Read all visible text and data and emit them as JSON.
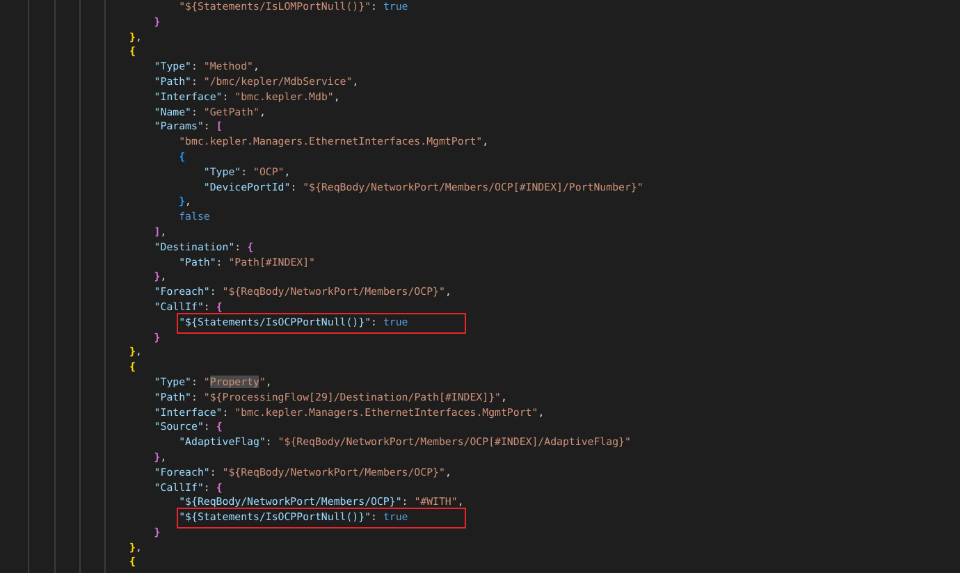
{
  "editor": {
    "lines": [
      {
        "children": [
          {
            "children": [
              {
                "boxed": false,
                "tokens": [
                  {
                    "kind": "string",
                    "text": "\"${Statements/IsLOMPortNull()}\""
                  },
                  {
                    "kind": "punct",
                    "text": ": "
                  },
                  {
                    "kind": "literal",
                    "text": "true"
                  }
                ]
              }
            ]
          },
          {
            "boxed": false,
            "tokens": [
              {
                "kind": "bracket",
                "color": "#da70d6",
                "text": "}"
              }
            ]
          }
        ]
      },
      {
        "boxed": false,
        "tokens": [
          {
            "kind": "bracket",
            "color": "#ffd700",
            "text": "}"
          },
          {
            "kind": "punct",
            "text": ","
          }
        ]
      },
      {
        "boxed": false,
        "tokens": [
          {
            "kind": "bracket",
            "color": "#ffd700",
            "text": "{"
          }
        ],
        "children": [
          {
            "boxed": false,
            "tokens": [
              {
                "kind": "key",
                "text": "\"Type\""
              },
              {
                "kind": "punct",
                "text": ": "
              },
              {
                "kind": "string",
                "text": "\"Method\""
              },
              {
                "kind": "punct",
                "text": ","
              }
            ]
          },
          {
            "boxed": false,
            "tokens": [
              {
                "kind": "key",
                "text": "\"Path\""
              },
              {
                "kind": "punct",
                "text": ": "
              },
              {
                "kind": "string",
                "text": "\"/bmc/kepler/MdbService\""
              },
              {
                "kind": "punct",
                "text": ","
              }
            ]
          },
          {
            "boxed": false,
            "tokens": [
              {
                "kind": "key",
                "text": "\"Interface\""
              },
              {
                "kind": "punct",
                "text": ": "
              },
              {
                "kind": "string",
                "text": "\"bmc.kepler.Mdb\""
              },
              {
                "kind": "punct",
                "text": ","
              }
            ]
          },
          {
            "boxed": false,
            "tokens": [
              {
                "kind": "key",
                "text": "\"Name\""
              },
              {
                "kind": "punct",
                "text": ": "
              },
              {
                "kind": "string",
                "text": "\"GetPath\""
              },
              {
                "kind": "punct",
                "text": ","
              }
            ]
          },
          {
            "boxed": false,
            "tokens": [
              {
                "kind": "key",
                "text": "\"Params\""
              },
              {
                "kind": "punct",
                "text": ": "
              },
              {
                "kind": "bracket",
                "color": "#da70d6",
                "text": "["
              }
            ],
            "children": [
              {
                "boxed": false,
                "tokens": [
                  {
                    "kind": "string",
                    "text": "\"bmc.kepler.Managers.EthernetInterfaces.MgmtPort\""
                  },
                  {
                    "kind": "punct",
                    "text": ","
                  }
                ]
              },
              {
                "boxed": false,
                "tokens": [
                  {
                    "kind": "bracket",
                    "color": "#179fff",
                    "text": "{"
                  }
                ],
                "children": [
                  {
                    "boxed": false,
                    "tokens": [
                      {
                        "kind": "key",
                        "text": "\"Type\""
                      },
                      {
                        "kind": "punct",
                        "text": ": "
                      },
                      {
                        "kind": "string",
                        "text": "\"OCP\""
                      },
                      {
                        "kind": "punct",
                        "text": ","
                      }
                    ]
                  },
                  {
                    "boxed": false,
                    "tokens": [
                      {
                        "kind": "key",
                        "text": "\"DevicePortId\""
                      },
                      {
                        "kind": "punct",
                        "text": ": "
                      },
                      {
                        "kind": "string",
                        "text": "\"${ReqBody/NetworkPort/Members/OCP[#INDEX]/PortNumber}\""
                      }
                    ]
                  }
                ]
              },
              {
                "boxed": false,
                "tokens": [
                  {
                    "kind": "bracket",
                    "color": "#179fff",
                    "text": "}"
                  },
                  {
                    "kind": "punct",
                    "text": ","
                  }
                ]
              },
              {
                "boxed": false,
                "tokens": [
                  {
                    "kind": "literal",
                    "text": "false"
                  }
                ]
              }
            ]
          },
          {
            "boxed": false,
            "tokens": [
              {
                "kind": "bracket",
                "color": "#da70d6",
                "text": "]"
              },
              {
                "kind": "punct",
                "text": ","
              }
            ]
          },
          {
            "boxed": false,
            "tokens": [
              {
                "kind": "key",
                "text": "\"Destination\""
              },
              {
                "kind": "punct",
                "text": ": "
              },
              {
                "kind": "bracket",
                "color": "#da70d6",
                "text": "{"
              }
            ],
            "children": [
              {
                "boxed": false,
                "tokens": [
                  {
                    "kind": "key",
                    "text": "\"Path\""
                  },
                  {
                    "kind": "punct",
                    "text": ": "
                  },
                  {
                    "kind": "string",
                    "text": "\"Path[#INDEX]\""
                  }
                ]
              }
            ]
          },
          {
            "boxed": false,
            "tokens": [
              {
                "kind": "bracket",
                "color": "#da70d6",
                "text": "}"
              },
              {
                "kind": "punct",
                "text": ","
              }
            ]
          },
          {
            "boxed": false,
            "tokens": [
              {
                "kind": "key",
                "text": "\"Foreach\""
              },
              {
                "kind": "punct",
                "text": ": "
              },
              {
                "kind": "string",
                "text": "\"${ReqBody/NetworkPort/Members/OCP}\""
              },
              {
                "kind": "punct",
                "text": ","
              }
            ]
          },
          {
            "boxed": false,
            "tokens": [
              {
                "kind": "key",
                "text": "\"CallIf\""
              },
              {
                "kind": "punct",
                "text": ": "
              },
              {
                "kind": "bracket",
                "color": "#da70d6",
                "text": "{"
              }
            ],
            "children": [
              {
                "boxed": true,
                "tokens": [
                  {
                    "kind": "key",
                    "text": "\"${Statements/IsOCPPortNull()}\""
                  },
                  {
                    "kind": "punct",
                    "text": ": "
                  },
                  {
                    "kind": "literal",
                    "text": "true"
                  }
                ]
              }
            ]
          },
          {
            "boxed": false,
            "tokens": [
              {
                "kind": "bracket",
                "color": "#da70d6",
                "text": "}"
              }
            ]
          }
        ]
      },
      {
        "boxed": false,
        "tokens": [
          {
            "kind": "bracket",
            "color": "#ffd700",
            "text": "}"
          },
          {
            "kind": "punct",
            "text": ","
          }
        ]
      },
      {
        "boxed": false,
        "tokens": [
          {
            "kind": "bracket",
            "color": "#ffd700",
            "text": "{"
          }
        ],
        "children": [
          {
            "boxed": false,
            "tokens": [
              {
                "kind": "key",
                "text": "\"Type\""
              },
              {
                "kind": "punct",
                "text": ": "
              },
              {
                "kind": "string",
                "text": "\""
              },
              {
                "kind": "match",
                "text": "Property"
              },
              {
                "kind": "string",
                "text": "\""
              },
              {
                "kind": "punct",
                "text": ","
              }
            ]
          },
          {
            "boxed": false,
            "tokens": [
              {
                "kind": "key",
                "text": "\"Path\""
              },
              {
                "kind": "punct",
                "text": ": "
              },
              {
                "kind": "string",
                "text": "\"${ProcessingFlow[29]/Destination/Path[#INDEX]}\""
              },
              {
                "kind": "punct",
                "text": ","
              }
            ]
          },
          {
            "boxed": false,
            "tokens": [
              {
                "kind": "key",
                "text": "\"Interface\""
              },
              {
                "kind": "punct",
                "text": ": "
              },
              {
                "kind": "string",
                "text": "\"bmc.kepler.Managers.EthernetInterfaces.MgmtPort\""
              },
              {
                "kind": "punct",
                "text": ","
              }
            ]
          },
          {
            "boxed": false,
            "tokens": [
              {
                "kind": "key",
                "text": "\"Source\""
              },
              {
                "kind": "punct",
                "text": ": "
              },
              {
                "kind": "bracket",
                "color": "#da70d6",
                "text": "{"
              }
            ],
            "children": [
              {
                "boxed": false,
                "tokens": [
                  {
                    "kind": "key",
                    "text": "\"AdaptiveFlag\""
                  },
                  {
                    "kind": "punct",
                    "text": ": "
                  },
                  {
                    "kind": "string",
                    "text": "\"${ReqBody/NetworkPort/Members/OCP[#INDEX]/AdaptiveFlag}\""
                  }
                ]
              }
            ]
          },
          {
            "boxed": false,
            "tokens": [
              {
                "kind": "bracket",
                "color": "#da70d6",
                "text": "}"
              },
              {
                "kind": "punct",
                "text": ","
              }
            ]
          },
          {
            "boxed": false,
            "tokens": [
              {
                "kind": "key",
                "text": "\"Foreach\""
              },
              {
                "kind": "punct",
                "text": ": "
              },
              {
                "kind": "string",
                "text": "\"${ReqBody/NetworkPort/Members/OCP}\""
              },
              {
                "kind": "punct",
                "text": ","
              }
            ]
          },
          {
            "boxed": false,
            "tokens": [
              {
                "kind": "key",
                "text": "\"CallIf\""
              },
              {
                "kind": "punct",
                "text": ": "
              },
              {
                "kind": "bracket",
                "color": "#da70d6",
                "text": "{"
              }
            ],
            "children": [
              {
                "boxed": false,
                "tokens": [
                  {
                    "kind": "key",
                    "text": "\"${ReqBody/NetworkPort/Members/OCP}\""
                  },
                  {
                    "kind": "punct",
                    "text": ": "
                  },
                  {
                    "kind": "string",
                    "text": "\"#WITH\""
                  },
                  {
                    "kind": "punct",
                    "text": ","
                  }
                ]
              },
              {
                "boxed": true,
                "tokens": [
                  {
                    "kind": "key",
                    "text": "\"${Statements/IsOCPPortNull()}\""
                  },
                  {
                    "kind": "punct",
                    "text": ": "
                  },
                  {
                    "kind": "literal",
                    "text": "true"
                  }
                ]
              }
            ]
          },
          {
            "boxed": false,
            "tokens": [
              {
                "kind": "bracket",
                "color": "#da70d6",
                "text": "}"
              }
            ]
          }
        ]
      },
      {
        "boxed": false,
        "tokens": [
          {
            "kind": "bracket",
            "color": "#ffd700",
            "text": "}"
          },
          {
            "kind": "punct",
            "text": ","
          }
        ]
      },
      {
        "boxed": false,
        "tokens": [
          {
            "kind": "bracket",
            "color": "#ffd700",
            "text": "{"
          }
        ]
      }
    ]
  }
}
